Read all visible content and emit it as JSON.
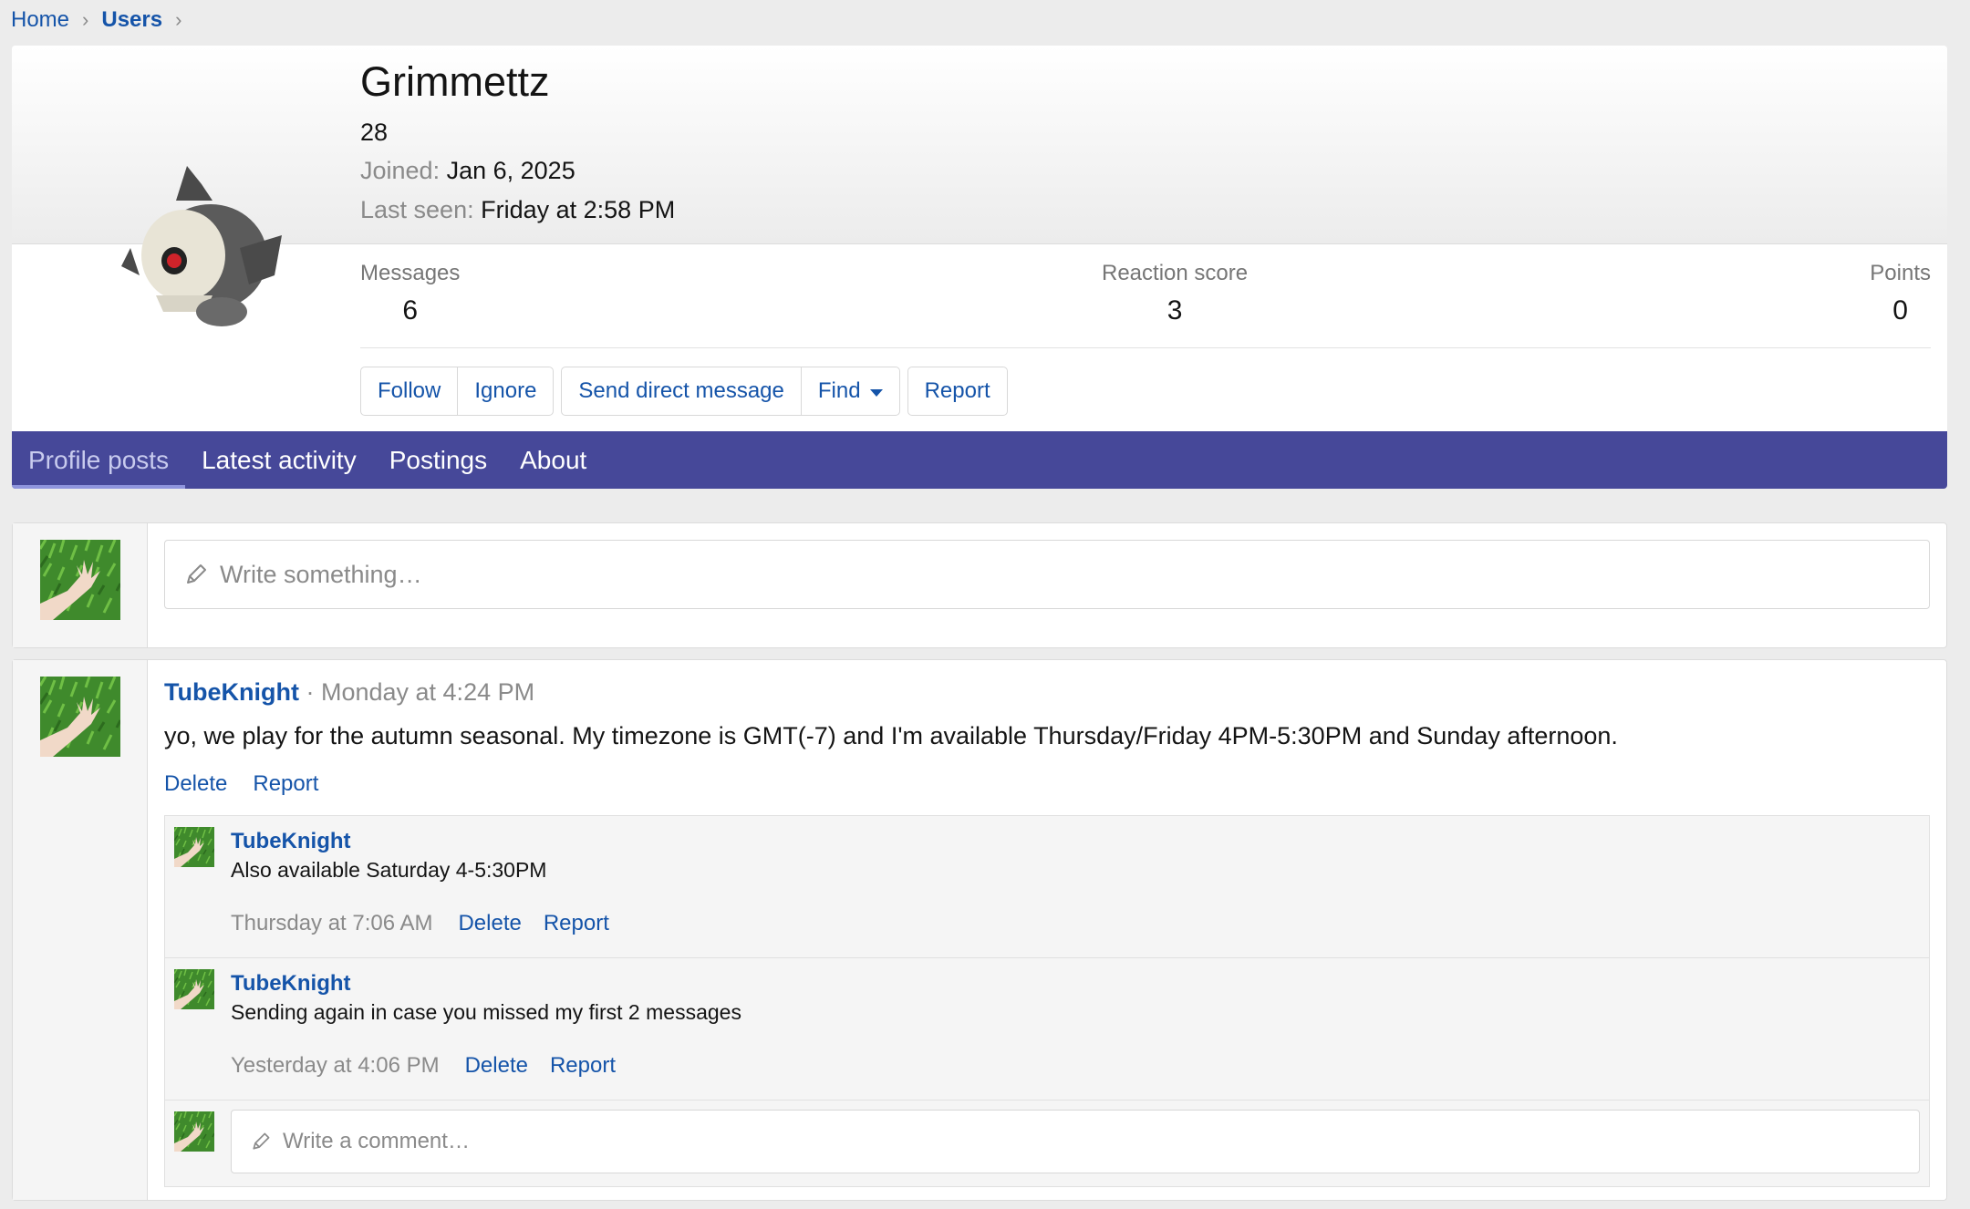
{
  "breadcrumb": {
    "items": [
      "Home",
      "Users"
    ]
  },
  "profile": {
    "username": "Grimmettz",
    "title_line": "28",
    "joined_label": "Joined:",
    "joined_value": "Jan 6, 2025",
    "last_seen_label": "Last seen:",
    "last_seen_value": "Friday at 2:58 PM",
    "stats": [
      {
        "label": "Messages",
        "value": "6"
      },
      {
        "label": "Reaction score",
        "value": "3"
      },
      {
        "label": "Points",
        "value": "0"
      }
    ],
    "actions": {
      "follow": "Follow",
      "ignore": "Ignore",
      "send_dm": "Send direct message",
      "find": "Find",
      "report": "Report"
    }
  },
  "tabs": [
    "Profile posts",
    "Latest activity",
    "Postings",
    "About"
  ],
  "composer": {
    "placeholder": "Write something…"
  },
  "post": {
    "author": "TubeKnight",
    "separator": " · ",
    "time": "Monday at 4:24 PM",
    "body": "yo, we play for the autumn seasonal. My timezone is GMT(-7) and I'm available Thursday/Friday 4PM-5:30PM and Sunday afternoon.",
    "delete": "Delete",
    "report": "Report",
    "comments": [
      {
        "author": "TubeKnight",
        "text": "Also available Saturday 4-5:30PM",
        "time": "Thursday at 7:06 AM",
        "delete": "Delete",
        "report": "Report"
      },
      {
        "author": "TubeKnight",
        "text": "Sending again in case you missed my first 2 messages",
        "time": "Yesterday at 4:06 PM",
        "delete": "Delete",
        "report": "Report"
      }
    ],
    "comment_placeholder": "Write a comment…"
  },
  "colors": {
    "link": "#1554a9",
    "tab_bar": "#464899",
    "page_bg": "#ececec"
  }
}
